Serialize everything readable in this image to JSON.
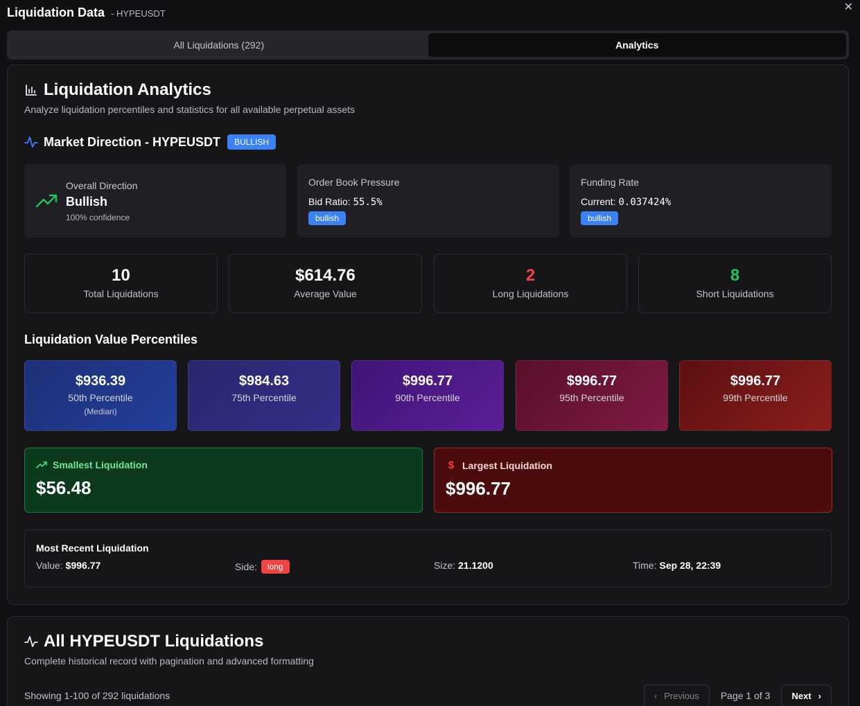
{
  "header": {
    "title": "Liquidation Data",
    "symbol": "- HYPEUSDT",
    "close_icon": "close-icon"
  },
  "tabs": [
    {
      "label": "All Liquidations (292)",
      "active": false
    },
    {
      "label": "Analytics",
      "active": true
    }
  ],
  "analytics": {
    "title": "Liquidation Analytics",
    "description": "Analyze liquidation percentiles and statistics for all available perpetual assets",
    "market_direction": {
      "title": "Market Direction - HYPEUSDT",
      "badge": "BULLISH",
      "overall": {
        "label": "Overall Direction",
        "value": "Bullish",
        "confidence": "100% confidence"
      },
      "order_book": {
        "label": "Order Book Pressure",
        "metric_label": "Bid Ratio:",
        "metric_value": "55.5%",
        "signal": "bullish"
      },
      "funding": {
        "label": "Funding Rate",
        "metric_label": "Current:",
        "metric_value": "0.037424%",
        "signal": "bullish"
      }
    },
    "stats": [
      {
        "value": "10",
        "label": "Total Liquidations",
        "color": "#ffffff"
      },
      {
        "value": "$614.76",
        "label": "Average Value",
        "color": "#ffffff"
      },
      {
        "value": "2",
        "label": "Long Liquidations",
        "color": "#ef4444"
      },
      {
        "value": "8",
        "label": "Short Liquidations",
        "color": "#22c55e"
      }
    ],
    "percentiles_title": "Liquidation Value Percentiles",
    "percentiles": [
      {
        "value": "$936.39",
        "label": "50th Percentile",
        "sub": "(Median)"
      },
      {
        "value": "$984.63",
        "label": "75th Percentile",
        "sub": ""
      },
      {
        "value": "$996.77",
        "label": "90th Percentile",
        "sub": ""
      },
      {
        "value": "$996.77",
        "label": "95th Percentile",
        "sub": ""
      },
      {
        "value": "$996.77",
        "label": "99th Percentile",
        "sub": ""
      }
    ],
    "smallest": {
      "label": "Smallest Liquidation",
      "value": "$56.48"
    },
    "largest": {
      "label": "Largest Liquidation",
      "value": "$996.77"
    },
    "recent": {
      "title": "Most Recent Liquidation",
      "value_label": "Value:",
      "value": "$996.77",
      "side_label": "Side:",
      "side": "long",
      "size_label": "Size:",
      "size": "21.1200",
      "time_label": "Time:",
      "time": "Sep 28, 22:39"
    }
  },
  "all_liquidations": {
    "title": "All HYPEUSDT Liquidations",
    "description": "Complete historical record with pagination and advanced formatting",
    "showing": "Showing 1-100 of 292 liquidations",
    "prev_label": "Previous",
    "page_info": "Page 1 of 3",
    "next_label": "Next"
  }
}
